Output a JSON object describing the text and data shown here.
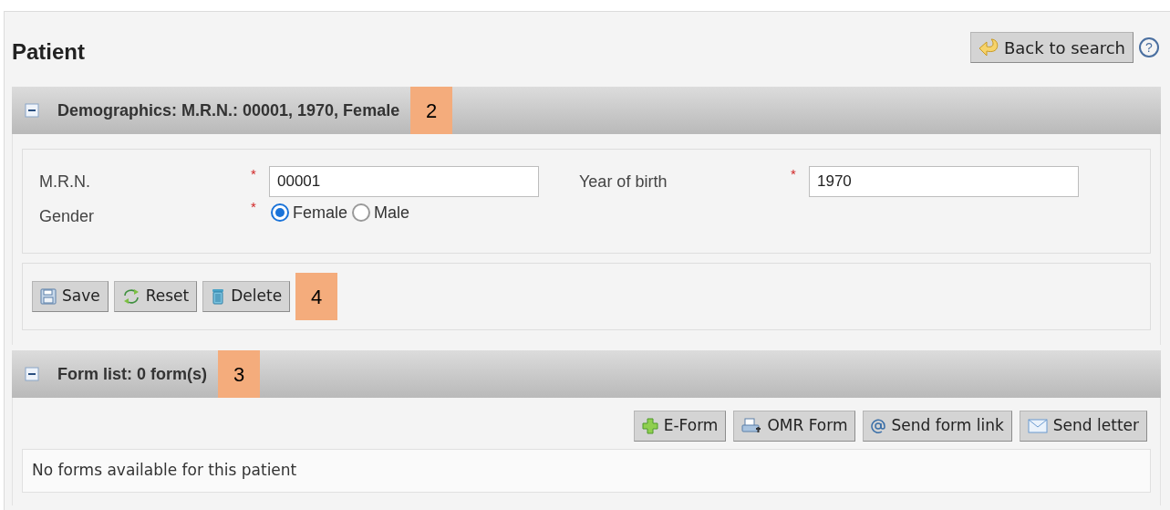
{
  "page": {
    "title": "Patient",
    "back_button": "Back to search",
    "help": "?"
  },
  "demographics": {
    "header": "Demographics: M.R.N.: 00001, 1970, Female",
    "expanded": true,
    "callout": "2",
    "fields": [
      {
        "label": "M.R.N.",
        "required": "*",
        "value": "00001"
      },
      {
        "label": "Year of birth",
        "required": "*",
        "value": "1970"
      }
    ],
    "gender": {
      "label": "Gender",
      "required": "*",
      "options": [
        {
          "label": "Female",
          "selected": true
        },
        {
          "label": "Male",
          "selected": false
        }
      ]
    },
    "buttons": [
      {
        "kind": "save",
        "label": "Save"
      },
      {
        "kind": "reset",
        "label": "Reset"
      },
      {
        "kind": "delete",
        "label": "Delete"
      }
    ],
    "buttons_callout": "4"
  },
  "form_list": {
    "header": "Form list: 0 form(s)",
    "expanded": true,
    "callout": "3",
    "buttons": [
      {
        "kind": "add",
        "label": "E-Form"
      },
      {
        "kind": "scan",
        "label": "OMR Form"
      },
      {
        "kind": "link",
        "label": "Send form link"
      },
      {
        "kind": "letter",
        "label": "Send letter"
      }
    ],
    "empty_message": "No forms available for this patient"
  }
}
